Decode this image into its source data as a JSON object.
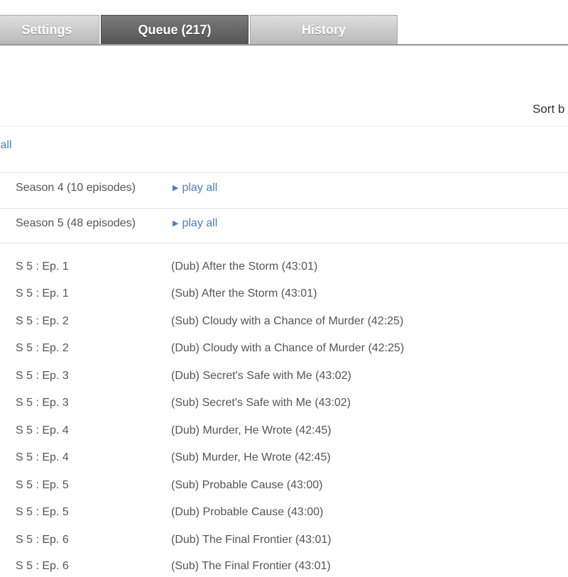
{
  "tabs": {
    "settings": "Settings",
    "queue": "Queue (217)",
    "history": "History"
  },
  "sort_label": "Sort b",
  "play_all_top": "y all",
  "seasons": [
    {
      "label": "Season 4 (10 episodes)",
      "play": "play all"
    },
    {
      "label": "Season 5 (48 episodes)",
      "play": "play all"
    }
  ],
  "episodes": [
    {
      "num": "S 5 : Ep. 1",
      "title": "(Dub) After the Storm (43:01)"
    },
    {
      "num": "S 5 : Ep. 1",
      "title": "(Sub) After the Storm (43:01)"
    },
    {
      "num": "S 5 : Ep. 2",
      "title": "(Sub) Cloudy with a Chance of Murder (42:25)"
    },
    {
      "num": "S 5 : Ep. 2",
      "title": "(Dub) Cloudy with a Chance of Murder (42:25)"
    },
    {
      "num": "S 5 : Ep. 3",
      "title": "(Dub) Secret's Safe with Me (43:02)"
    },
    {
      "num": "S 5 : Ep. 3",
      "title": "(Sub) Secret's Safe with Me (43:02)"
    },
    {
      "num": "S 5 : Ep. 4",
      "title": "(Dub) Murder, He Wrote (42:45)"
    },
    {
      "num": "S 5 : Ep. 4",
      "title": "(Sub) Murder, He Wrote (42:45)"
    },
    {
      "num": "S 5 : Ep. 5",
      "title": "(Sub) Probable Cause (43:00)"
    },
    {
      "num": "S 5 : Ep. 5",
      "title": "(Dub) Probable Cause (43:00)"
    },
    {
      "num": "S 5 : Ep. 6",
      "title": "(Dub) The Final Frontier (43:01)"
    },
    {
      "num": "S 5 : Ep. 6",
      "title": "(Sub) The Final Frontier (43:01)"
    }
  ]
}
